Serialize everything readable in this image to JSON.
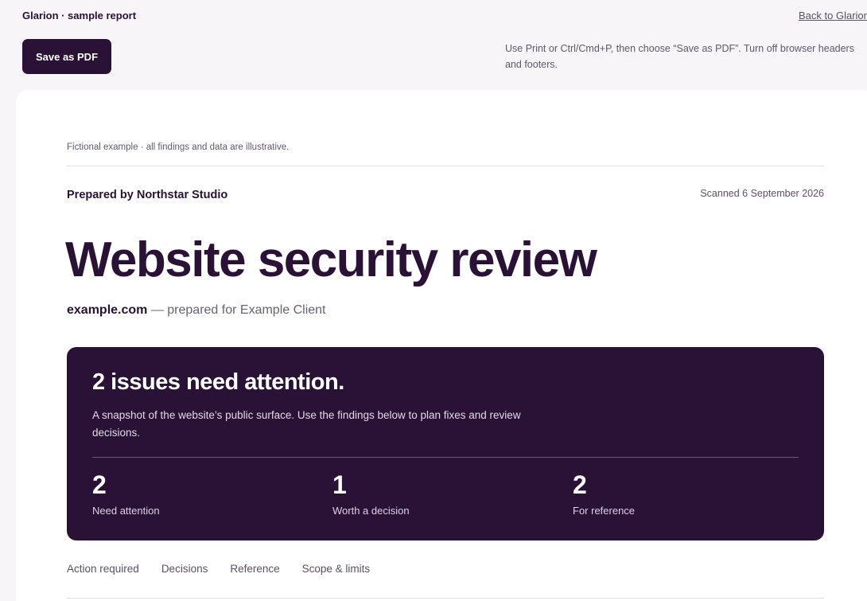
{
  "topbar": {
    "brand": "Glarion · sample report",
    "back_link": "Back to Glarion",
    "save_button": "Save as PDF",
    "print_hint": "Use Print or Ctrl/Cmd+P, then choose “Save as PDF”. Turn off browser headers and footers."
  },
  "report": {
    "disclaimer": "Fictional example · all findings and data are illustrative.",
    "prepared_by": "Prepared by Northstar Studio",
    "scanned": "Scanned 6 September 2026",
    "title": "Website security review",
    "domain": "example.com",
    "subtitle_rest": " — prepared for Example Client"
  },
  "summary": {
    "headline": "2 issues need attention.",
    "description": "A snapshot of the website’s public surface. Use the findings below to plan fixes and review decisions.",
    "stats": [
      {
        "value": "2",
        "label": "Need attention"
      },
      {
        "value": "1",
        "label": "Worth a decision"
      },
      {
        "value": "2",
        "label": "For reference"
      }
    ]
  },
  "tabs": [
    {
      "label": "Action required"
    },
    {
      "label": "Decisions"
    },
    {
      "label": "Reference"
    },
    {
      "label": "Scope & limits"
    }
  ]
}
